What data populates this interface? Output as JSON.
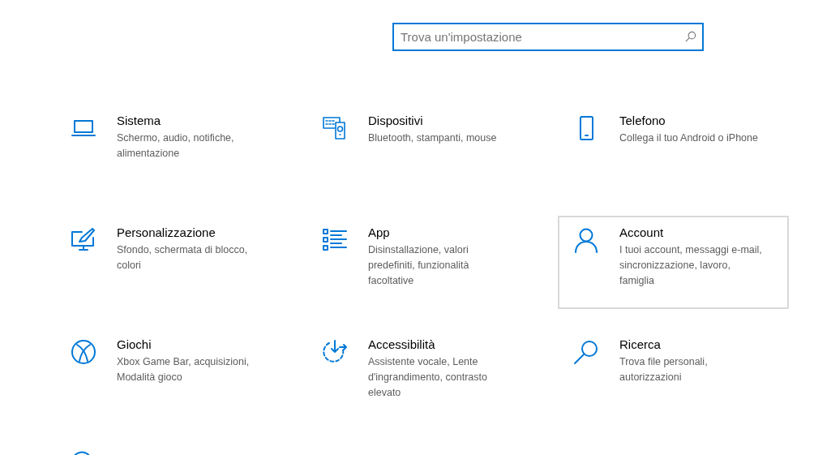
{
  "search": {
    "placeholder": "Trova un'impostazione"
  },
  "tiles": [
    {
      "title": "Sistema",
      "description": "Schermo, audio, notifiche, alimentazione",
      "hovered": false
    },
    {
      "title": "Dispositivi",
      "description": "Bluetooth, stampanti, mouse",
      "hovered": false
    },
    {
      "title": "Telefono",
      "description": "Collega il tuo Android o iPhone",
      "hovered": false
    },
    {
      "title": "Personalizzazione",
      "description": "Sfondo, schermata di blocco, colori",
      "hovered": false
    },
    {
      "title": "App",
      "description": "Disinstallazione, valori predefiniti, funzionalità facoltative",
      "hovered": false
    },
    {
      "title": "Account",
      "description": "I tuoi account, messaggi e-mail, sincronizzazione, lavoro, famiglia",
      "hovered": true
    },
    {
      "title": "Giochi",
      "description": "Xbox Game Bar, acquisizioni, Modalità gioco",
      "hovered": false
    },
    {
      "title": "Accessibilità",
      "description": "Assistente vocale, Lente d'ingrandimento, contrasto elevato",
      "hovered": false
    },
    {
      "title": "Ricerca",
      "description": "Trova file personali, autorizzazioni",
      "hovered": false
    }
  ]
}
